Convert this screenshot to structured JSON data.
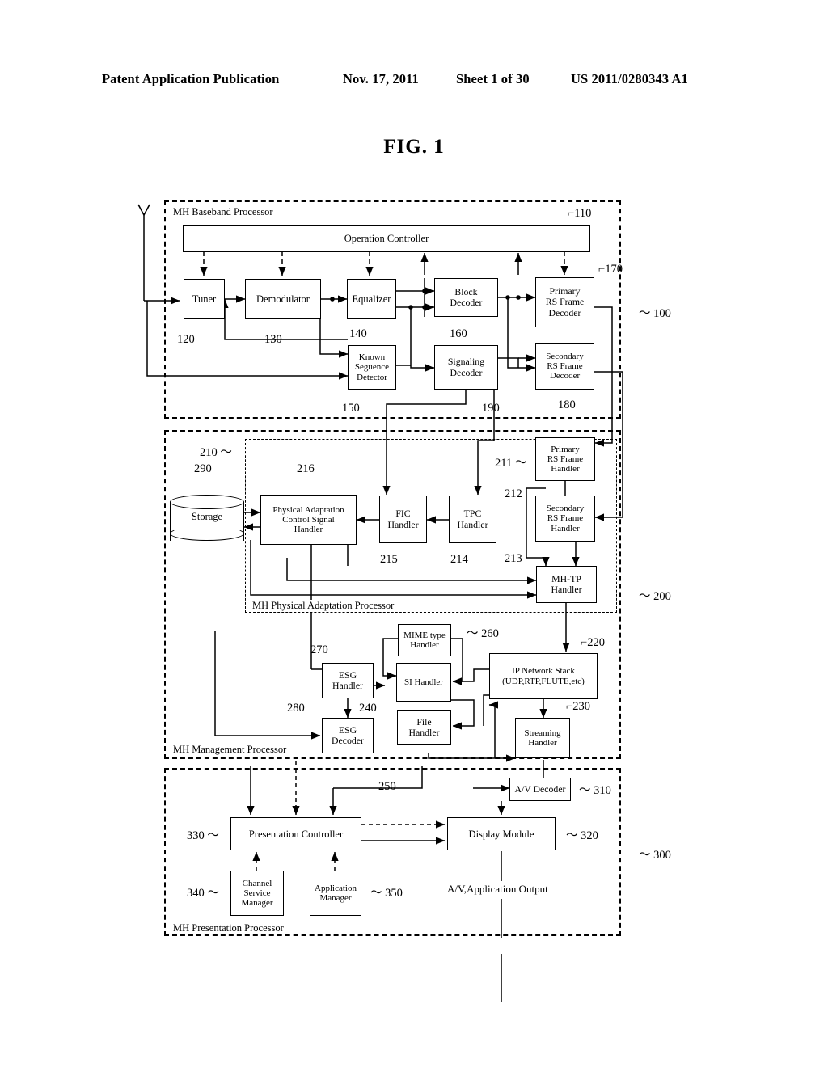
{
  "header": {
    "publication": "Patent Application Publication",
    "date": "Nov. 17, 2011",
    "sheet": "Sheet 1 of 30",
    "number": "US 2011/0280343 A1"
  },
  "figure": {
    "title": "FIG. 1"
  },
  "groups": [
    {
      "id": "baseband",
      "label": "MH Baseband Processor",
      "ref": "100"
    },
    {
      "id": "physadapt",
      "label": "MH Physical Adaptation Processor",
      "ref": "210"
    },
    {
      "id": "management",
      "label": "MH Management Processor",
      "ref": "200"
    },
    {
      "id": "presentation",
      "label": "MH Presentation Processor",
      "ref": "300"
    }
  ],
  "blocks": [
    {
      "id": "operation_controller",
      "label": "Operation Controller",
      "ref": "110"
    },
    {
      "id": "tuner",
      "label": "Tuner",
      "ref": "120"
    },
    {
      "id": "demodulator",
      "label": "Demodulator",
      "ref": "130"
    },
    {
      "id": "equalizer",
      "label": "Equalizer",
      "ref": "140"
    },
    {
      "id": "block_decoder",
      "label": "Block\nDecoder",
      "ref": "160"
    },
    {
      "id": "primary_rs_decoder",
      "label": "Primary\nRS Frame\nDecoder",
      "ref": "170"
    },
    {
      "id": "known_sequence",
      "label": "Known\nSeguence\nDetector",
      "ref": "150"
    },
    {
      "id": "signaling_decoder",
      "label": "Signaling\nDecoder",
      "ref": "190"
    },
    {
      "id": "secondary_rs_decoder",
      "label": "Secondary\nRS Frame\nDecoder",
      "ref": "180"
    },
    {
      "id": "storage",
      "label": "Storage",
      "ref": "290"
    },
    {
      "id": "pa_control_handler",
      "label": "Physical Adaptation\nControl Signal\nHandler",
      "ref": "216"
    },
    {
      "id": "fic_handler",
      "label": "FIC\nHandler",
      "ref": "215"
    },
    {
      "id": "tpc_handler",
      "label": "TPC\nHandler",
      "ref": "214"
    },
    {
      "id": "primary_rs_handler",
      "label": "Primary\nRS Frame\nHandler",
      "ref": "211"
    },
    {
      "id": "secondary_rs_handler",
      "label": "Secondary\nRS Frame\nHandler",
      "ref": "212"
    },
    {
      "id": "mh_tp_handler",
      "label": "MH-TP\nHandler",
      "ref": "213"
    },
    {
      "id": "mime_type_handler",
      "label": "MIME type\nHandler",
      "ref": "260"
    },
    {
      "id": "esg_handler",
      "label": "ESG\nHandler",
      "ref": "270"
    },
    {
      "id": "si_handler",
      "label": "SI Handler",
      "ref": "240"
    },
    {
      "id": "ip_network_stack",
      "label": "IP Network Stack\n(UDP,RTP,FLUTE,etc)",
      "ref": "220"
    },
    {
      "id": "esg_decoder",
      "label": "ESG\nDecoder",
      "ref": "280"
    },
    {
      "id": "file_handler",
      "label": "File\nHandler",
      "ref": "250"
    },
    {
      "id": "streaming_handler",
      "label": "Streaming\nHandler",
      "ref": "230"
    },
    {
      "id": "av_decoder",
      "label": "A/V Decoder",
      "ref": "310"
    },
    {
      "id": "presentation_ctrl",
      "label": "Presentation Controller",
      "ref": "330"
    },
    {
      "id": "display_module",
      "label": "Display Module",
      "ref": "320"
    },
    {
      "id": "channel_service_mgr",
      "label": "Channel\nService\nManager",
      "ref": "340"
    },
    {
      "id": "application_manager",
      "label": "Application\nManager",
      "ref": "350"
    }
  ],
  "annotations": [
    {
      "id": "av_output",
      "label": "A/V,Application Output"
    }
  ],
  "icons": [
    {
      "id": "antenna-icon",
      "label": "antenna"
    }
  ],
  "colors": {
    "ink": "#000000",
    "paper": "#ffffff"
  }
}
